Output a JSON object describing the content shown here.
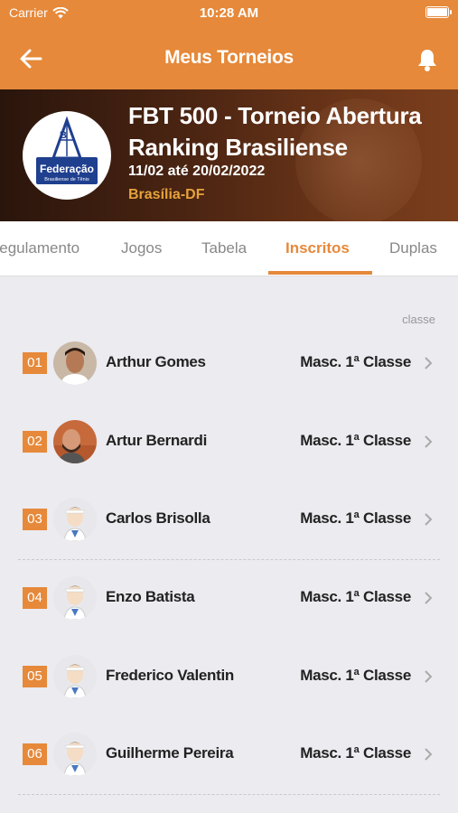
{
  "status_bar": {
    "carrier": "Carrier",
    "time": "10:28 AM"
  },
  "nav": {
    "title": "Meus Torneios",
    "back_icon": "arrow-left-icon",
    "bell_icon": "bell-icon"
  },
  "tournament": {
    "title": "FBT 500 - Torneio Abertura Ranking Brasiliense",
    "dates": "11/02 até 20/02/2022",
    "location": "Brasília-DF",
    "logo_text": "Federação",
    "logo_subtext": "Brasiliense de Tênis"
  },
  "tabs": [
    {
      "label": "Regulamento"
    },
    {
      "label": "Jogos"
    },
    {
      "label": "Tabela"
    },
    {
      "label": "Inscritos"
    },
    {
      "label": "Duplas"
    }
  ],
  "active_tab": "Inscritos",
  "list": {
    "column_header": "classe",
    "players": [
      {
        "num": "01",
        "name": "Arthur Gomes",
        "class": "Masc. 1ª Classe"
      },
      {
        "num": "02",
        "name": "Artur Bernardi",
        "class": "Masc. 1ª Classe"
      },
      {
        "num": "03",
        "name": "Carlos Brisolla",
        "class": "Masc. 1ª Classe"
      },
      {
        "num": "04",
        "name": "Enzo Batista",
        "class": "Masc. 1ª Classe"
      },
      {
        "num": "05",
        "name": "Frederico Valentin",
        "class": "Masc. 1ª Classe"
      },
      {
        "num": "06",
        "name": "Guilherme Pereira",
        "class": "Masc. 1ª Classe"
      }
    ]
  },
  "colors": {
    "accent": "#e6893a",
    "location": "#e6a23c",
    "logo_blue": "#1f3f8f"
  }
}
